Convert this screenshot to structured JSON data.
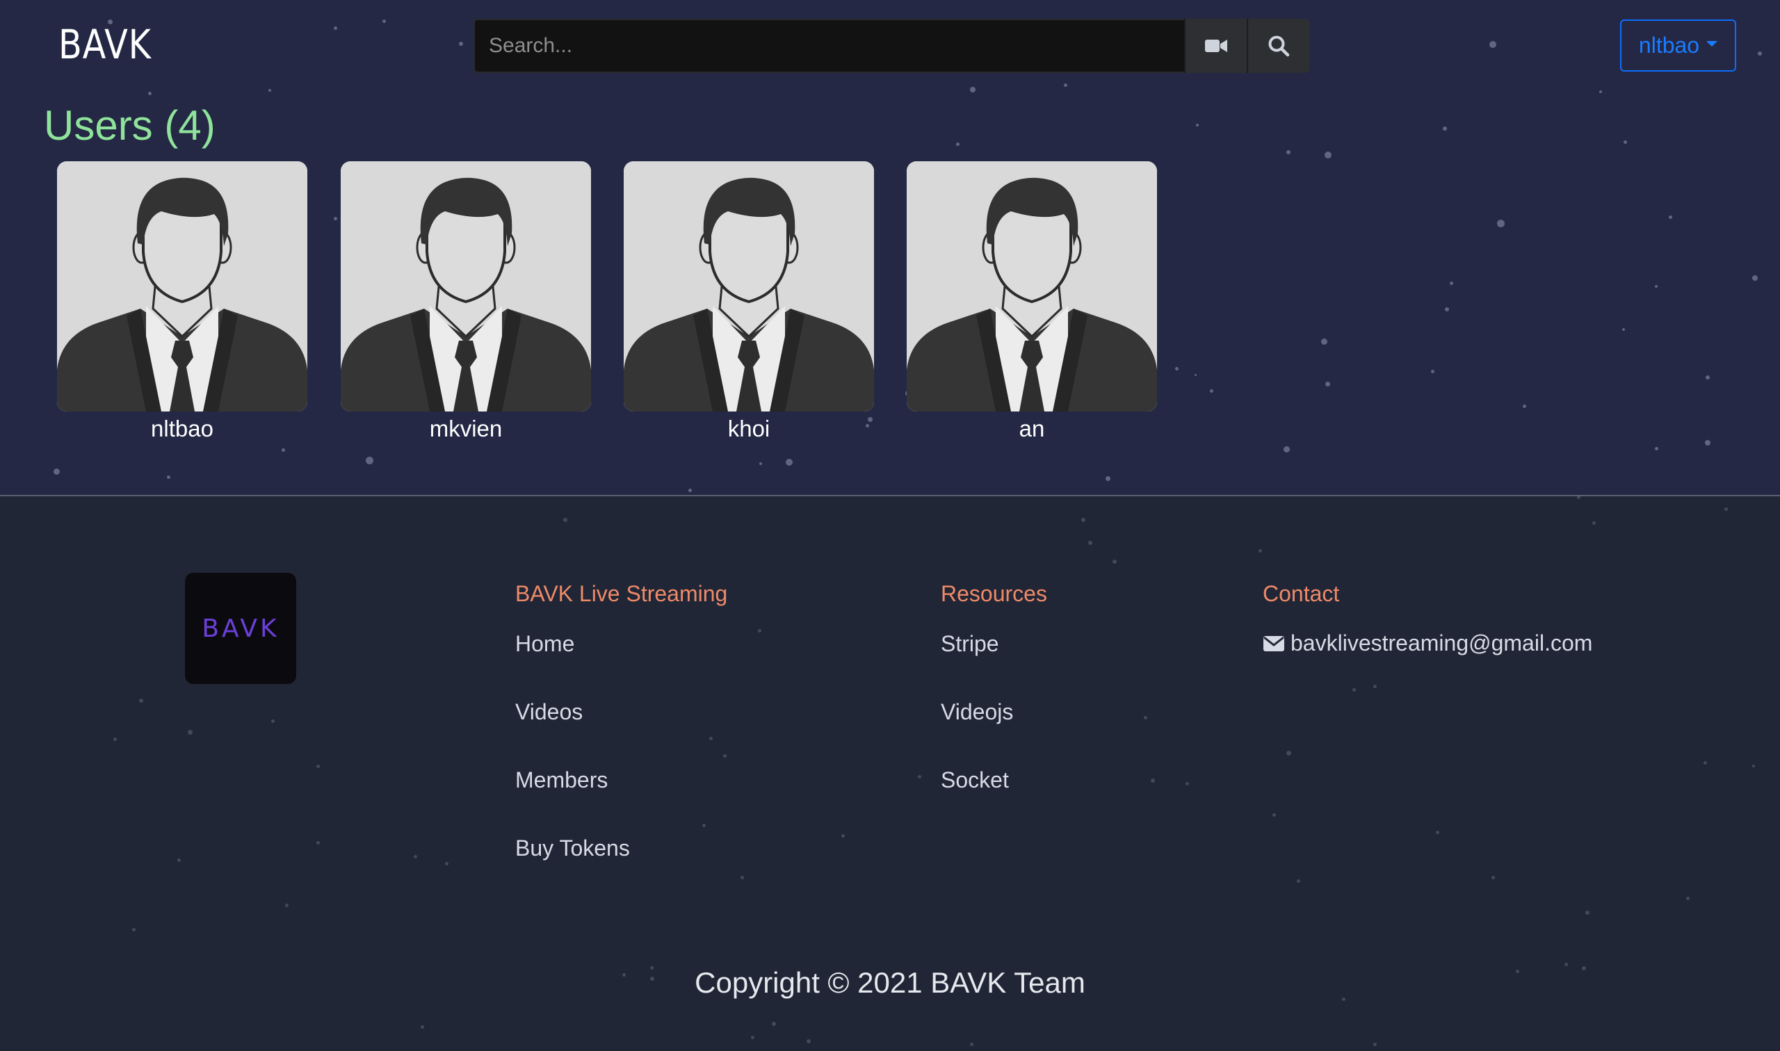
{
  "navbar": {
    "brand": "BAVK",
    "search_placeholder": "Search...",
    "user_menu_label": "nltbao"
  },
  "users_section": {
    "heading": "Users (4)",
    "users": [
      {
        "name": "nltbao"
      },
      {
        "name": "mkvien"
      },
      {
        "name": "khoi"
      },
      {
        "name": "an"
      }
    ]
  },
  "footer": {
    "logo_text": "BAVK",
    "columns": {
      "main": {
        "title": "BAVK Live Streaming",
        "links": [
          "Home",
          "Videos",
          "Members",
          "Buy Tokens"
        ]
      },
      "resources": {
        "title": "Resources",
        "links": [
          "Stripe",
          "Videojs",
          "Socket"
        ]
      },
      "contact": {
        "title": "Contact",
        "email": "bavklivestreaming@gmail.com"
      }
    },
    "copyright": "Copyright © 2021 BAVK Team"
  },
  "colors": {
    "background_top": "#242845",
    "background_footer": "#212636",
    "heading_green": "#8fe39a",
    "footer_heading_orange": "#ee8a68",
    "accent_blue": "#0d6efd"
  }
}
